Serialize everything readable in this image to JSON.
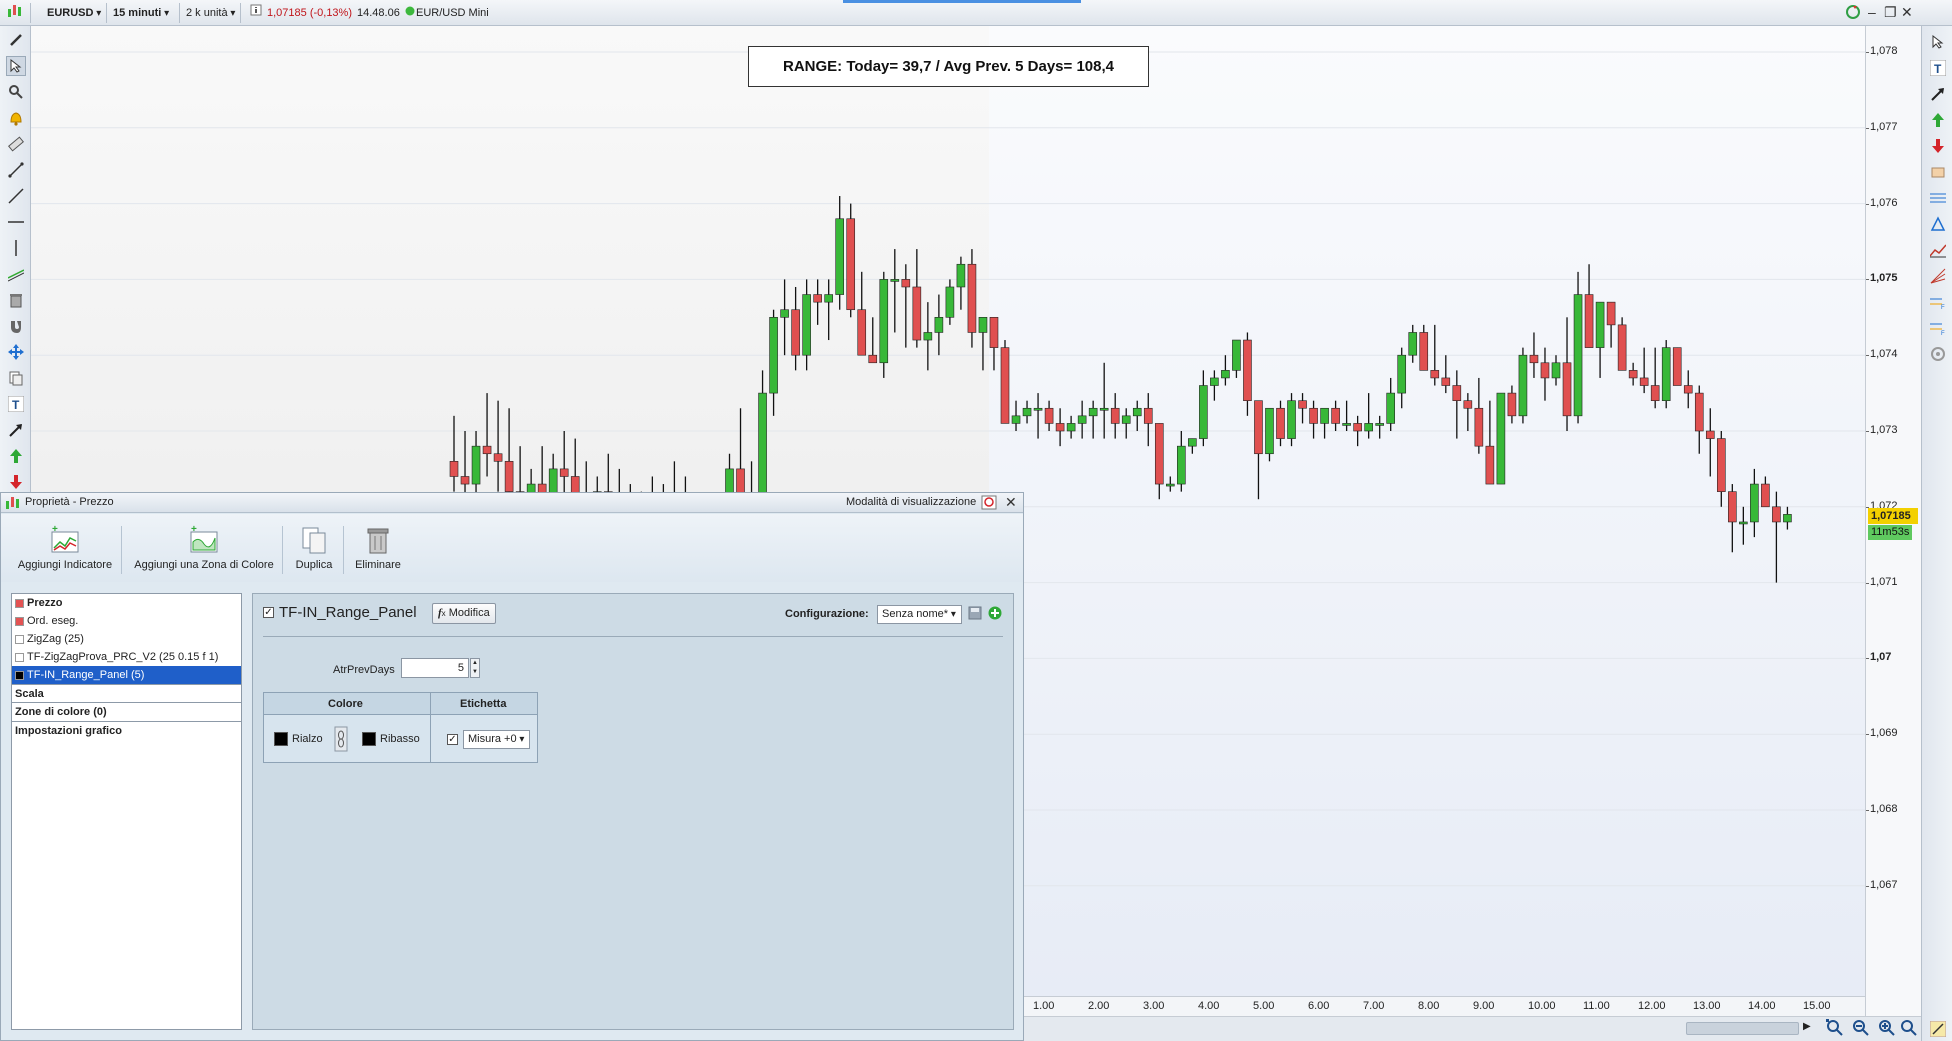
{
  "topbar": {
    "symbol": "EURUSD",
    "timeframe": "15 minuti",
    "units": "2 k unità",
    "price_change": "1,07185 (-0,13%)",
    "time": "14.48.06",
    "instrument": "EUR/USD Mini"
  },
  "chart": {
    "range_text": "RANGE: Today= 39,7  / Avg Prev. 5 Days= 108,4",
    "price_ticks": [
      {
        "label": "1,078",
        "bold": false
      },
      {
        "label": "1,077",
        "bold": false
      },
      {
        "label": "1,076",
        "bold": false
      },
      {
        "label": "1,075",
        "bold": true
      },
      {
        "label": "1,074",
        "bold": false
      },
      {
        "label": "1,073",
        "bold": false
      },
      {
        "label": "1,072",
        "bold": false
      },
      {
        "label": "1,071",
        "bold": false
      },
      {
        "label": "1,07",
        "bold": true
      },
      {
        "label": "1,069",
        "bold": false
      },
      {
        "label": "1,068",
        "bold": false
      },
      {
        "label": "1,067",
        "bold": false
      }
    ],
    "current_price": "1,07185",
    "countdown": "11m53s",
    "time_ticks": [
      "1.00",
      "2.00",
      "3.00",
      "4.00",
      "5.00",
      "6.00",
      "7.00",
      "8.00",
      "9.00",
      "10.00",
      "11.00",
      "12.00",
      "13.00",
      "14.00",
      "15.00"
    ],
    "colors": {
      "up": "#38b838",
      "down": "#e05050",
      "price_tag": "#f3d000",
      "countdown_tag": "#5fc95f"
    },
    "candles": [
      [
        1.0726,
        1.0732,
        1.0722,
        1.0724
      ],
      [
        1.0724,
        1.073,
        1.072,
        1.0723
      ],
      [
        1.0723,
        1.073,
        1.0719,
        1.0728
      ],
      [
        1.0728,
        1.0735,
        1.0724,
        1.0727
      ],
      [
        1.0727,
        1.0734,
        1.0722,
        1.0726
      ],
      [
        1.0726,
        1.0733,
        1.072,
        1.0722
      ],
      [
        1.0722,
        1.0728,
        1.0716,
        1.0719
      ],
      [
        1.0719,
        1.0725,
        1.0715,
        1.0723
      ],
      [
        1.0723,
        1.0728,
        1.0718,
        1.0721
      ],
      [
        1.0721,
        1.0727,
        1.0716,
        1.0725
      ],
      [
        1.0725,
        1.073,
        1.072,
        1.0724
      ],
      [
        1.0724,
        1.0729,
        1.0719,
        1.0721
      ],
      [
        1.0721,
        1.0726,
        1.0716,
        1.0718
      ],
      [
        1.0718,
        1.0724,
        1.0714,
        1.0722
      ],
      [
        1.0722,
        1.0727,
        1.0717,
        1.0719
      ],
      [
        1.0719,
        1.0725,
        1.0715,
        1.0718
      ],
      [
        1.0718,
        1.0723,
        1.0713,
        1.0716
      ],
      [
        1.0716,
        1.0722,
        1.0712,
        1.0718
      ],
      [
        1.0718,
        1.0724,
        1.0714,
        1.0717
      ],
      [
        1.0717,
        1.0723,
        1.0713,
        1.072
      ],
      [
        1.072,
        1.0726,
        1.0716,
        1.0719
      ],
      [
        1.0719,
        1.0724,
        1.0714,
        1.0716
      ],
      [
        1.0716,
        1.0721,
        1.0711,
        1.0714
      ],
      [
        1.0714,
        1.0719,
        1.071,
        1.0716
      ],
      [
        1.0716,
        1.0721,
        1.0712,
        1.0718
      ],
      [
        1.0718,
        1.0727,
        1.0716,
        1.0725
      ],
      [
        1.0725,
        1.0733,
        1.0722,
        1.0721
      ],
      [
        1.0721,
        1.0726,
        1.0717,
        1.0719
      ],
      [
        1.0719,
        1.0738,
        1.0718,
        1.0735
      ],
      [
        1.0735,
        1.0746,
        1.0732,
        1.0745
      ],
      [
        1.0745,
        1.075,
        1.074,
        1.0746
      ],
      [
        1.0746,
        1.0749,
        1.0738,
        1.074
      ],
      [
        1.074,
        1.075,
        1.0738,
        1.0748
      ],
      [
        1.0748,
        1.075,
        1.0744,
        1.0747
      ],
      [
        1.0747,
        1.075,
        1.0742,
        1.0748
      ],
      [
        1.0748,
        1.0761,
        1.0746,
        1.0758
      ],
      [
        1.0758,
        1.076,
        1.0745,
        1.0746
      ],
      [
        1.0746,
        1.0751,
        1.074,
        1.074
      ],
      [
        1.074,
        1.0745,
        1.0739,
        1.0739
      ],
      [
        1.0739,
        1.0751,
        1.0737,
        1.075
      ],
      [
        1.075,
        1.0754,
        1.0743,
        1.075
      ],
      [
        1.075,
        1.0752,
        1.0741,
        1.0749
      ],
      [
        1.0749,
        1.0754,
        1.0741,
        1.0742
      ],
      [
        1.0742,
        1.0747,
        1.0738,
        1.0743
      ],
      [
        1.0743,
        1.0748,
        1.074,
        1.0745
      ],
      [
        1.0745,
        1.075,
        1.0744,
        1.0749
      ],
      [
        1.0749,
        1.0753,
        1.0746,
        1.0752
      ],
      [
        1.0752,
        1.0754,
        1.0741,
        1.0743
      ],
      [
        1.0743,
        1.0745,
        1.0738,
        1.0745
      ],
      [
        1.0745,
        1.0745,
        1.0738,
        1.0741
      ],
      [
        1.0741,
        1.0742,
        1.0731,
        1.0731
      ],
      [
        1.0731,
        1.0734,
        1.073,
        1.0732
      ],
      [
        1.0732,
        1.0734,
        1.0731,
        1.0733
      ],
      [
        1.0733,
        1.0735,
        1.0729,
        1.0733
      ],
      [
        1.0733,
        1.0734,
        1.073,
        1.0731
      ],
      [
        1.0731,
        1.0733,
        1.0728,
        1.073
      ],
      [
        1.073,
        1.0732,
        1.0729,
        1.0731
      ],
      [
        1.0731,
        1.0734,
        1.0729,
        1.0732
      ],
      [
        1.0732,
        1.0734,
        1.0729,
        1.0733
      ],
      [
        1.0733,
        1.0739,
        1.0729,
        1.0733
      ],
      [
        1.0733,
        1.0735,
        1.0729,
        1.0731
      ],
      [
        1.0731,
        1.0733,
        1.0729,
        1.0732
      ],
      [
        1.0732,
        1.0734,
        1.073,
        1.0733
      ],
      [
        1.0733,
        1.0735,
        1.0728,
        1.0731
      ],
      [
        1.0731,
        1.0731,
        1.0721,
        1.0723
      ],
      [
        1.0723,
        1.0724,
        1.0722,
        1.0723
      ],
      [
        1.0723,
        1.073,
        1.0722,
        1.0728
      ],
      [
        1.0728,
        1.0729,
        1.0727,
        1.0729
      ],
      [
        1.0729,
        1.0738,
        1.0728,
        1.0736
      ],
      [
        1.0736,
        1.0738,
        1.0734,
        1.0737
      ],
      [
        1.0737,
        1.074,
        1.0736,
        1.0738
      ],
      [
        1.0738,
        1.0742,
        1.0737,
        1.0742
      ],
      [
        1.0742,
        1.0743,
        1.0732,
        1.0734
      ],
      [
        1.0734,
        1.0734,
        1.0721,
        1.0727
      ],
      [
        1.0727,
        1.0733,
        1.0726,
        1.0733
      ],
      [
        1.0733,
        1.0734,
        1.0728,
        1.0729
      ],
      [
        1.0729,
        1.0735,
        1.0728,
        1.0734
      ],
      [
        1.0734,
        1.0735,
        1.0731,
        1.0733
      ],
      [
        1.0733,
        1.0734,
        1.0729,
        1.0731
      ],
      [
        1.0731,
        1.0733,
        1.0729,
        1.0733
      ],
      [
        1.0733,
        1.0734,
        1.073,
        1.0731
      ],
      [
        1.0731,
        1.0734,
        1.073,
        1.0731
      ],
      [
        1.0731,
        1.0732,
        1.0728,
        1.073
      ],
      [
        1.073,
        1.0735,
        1.0729,
        1.0731
      ],
      [
        1.0731,
        1.0732,
        1.0729,
        1.0731
      ],
      [
        1.0731,
        1.0737,
        1.073,
        1.0735
      ],
      [
        1.0735,
        1.0741,
        1.0733,
        1.074
      ],
      [
        1.074,
        1.0744,
        1.0739,
        1.0743
      ],
      [
        1.0743,
        1.0744,
        1.0738,
        1.0738
      ],
      [
        1.0738,
        1.0744,
        1.0736,
        1.0737
      ],
      [
        1.0737,
        1.074,
        1.0735,
        1.0736
      ],
      [
        1.0736,
        1.0738,
        1.0729,
        1.0734
      ],
      [
        1.0734,
        1.0735,
        1.073,
        1.0733
      ],
      [
        1.0733,
        1.0737,
        1.0727,
        1.0728
      ],
      [
        1.0728,
        1.0734,
        1.0723,
        1.0723
      ],
      [
        1.0723,
        1.0735,
        1.0723,
        1.0735
      ],
      [
        1.0735,
        1.0736,
        1.0731,
        1.0732
      ],
      [
        1.0732,
        1.0741,
        1.0731,
        1.074
      ],
      [
        1.074,
        1.0743,
        1.0737,
        1.0739
      ],
      [
        1.0739,
        1.0741,
        1.0734,
        1.0737
      ],
      [
        1.0737,
        1.074,
        1.0736,
        1.0739
      ],
      [
        1.0739,
        1.0745,
        1.073,
        1.0732
      ],
      [
        1.0732,
        1.0751,
        1.0731,
        1.0748
      ],
      [
        1.0748,
        1.0752,
        1.0741,
        1.0741
      ],
      [
        1.0741,
        1.0747,
        1.0737,
        1.0747
      ],
      [
        1.0747,
        1.0747,
        1.0741,
        1.0744
      ],
      [
        1.0744,
        1.0745,
        1.0738,
        1.0738
      ],
      [
        1.0738,
        1.0739,
        1.0736,
        1.0737
      ],
      [
        1.0737,
        1.0741,
        1.0735,
        1.0736
      ],
      [
        1.0736,
        1.0741,
        1.0733,
        1.0734
      ],
      [
        1.0734,
        1.0742,
        1.0733,
        1.0741
      ],
      [
        1.0741,
        1.0741,
        1.0736,
        1.0736
      ],
      [
        1.0736,
        1.0738,
        1.0733,
        1.0735
      ],
      [
        1.0735,
        1.0736,
        1.0727,
        1.073
      ],
      [
        1.073,
        1.0733,
        1.0724,
        1.0729
      ],
      [
        1.0729,
        1.073,
        1.072,
        1.0722
      ],
      [
        1.0722,
        1.0723,
        1.0714,
        1.0718
      ],
      [
        1.0718,
        1.072,
        1.0715,
        1.0718
      ],
      [
        1.0718,
        1.0725,
        1.0716,
        1.0723
      ],
      [
        1.0723,
        1.0724,
        1.072,
        1.072
      ],
      [
        1.072,
        1.0722,
        1.071,
        1.0718
      ],
      [
        1.0718,
        1.072,
        1.0717,
        1.0719
      ]
    ]
  },
  "dialog": {
    "title": "Proprietà - Prezzo",
    "mode_label": "Modalità di visualizzazione",
    "toolbar": {
      "add_indicator": "Aggiungi Indicatore",
      "add_zone": "Aggiungi una Zona di Colore",
      "duplicate": "Duplica",
      "delete": "Eliminare"
    },
    "tree": {
      "items": [
        {
          "label": "Prezzo",
          "swatch": "#e35353",
          "bold": true,
          "selected": false
        },
        {
          "label": "Ord. eseg.",
          "swatch": "#e35353",
          "bold": false,
          "selected": false
        },
        {
          "label": "ZigZag (25)",
          "swatch": "#ffffff",
          "bold": false,
          "selected": false
        },
        {
          "label": "TF-ZigZagProva_PRC_V2 (25 0.15 f 1)",
          "swatch": "#ffffff",
          "bold": false,
          "selected": false
        },
        {
          "label": "TF-IN_Range_Panel (5)",
          "swatch": "#000000",
          "bold": false,
          "selected": true
        }
      ],
      "sections": [
        "Scala",
        "Zone di colore (0)",
        "Impostazioni grafico"
      ]
    },
    "editor": {
      "indicator_name": "TF-IN_Range_Panel",
      "modify_label": "Modifica",
      "config_label": "Configurazione:",
      "config_value": "Senza nome*",
      "param_label": "AtrPrevDays",
      "param_value": "5",
      "table": {
        "col_color": "Colore",
        "col_label": "Etichetta",
        "rise": "Rialzo",
        "fall": "Ribasso",
        "measure": "Misura +0"
      }
    }
  }
}
